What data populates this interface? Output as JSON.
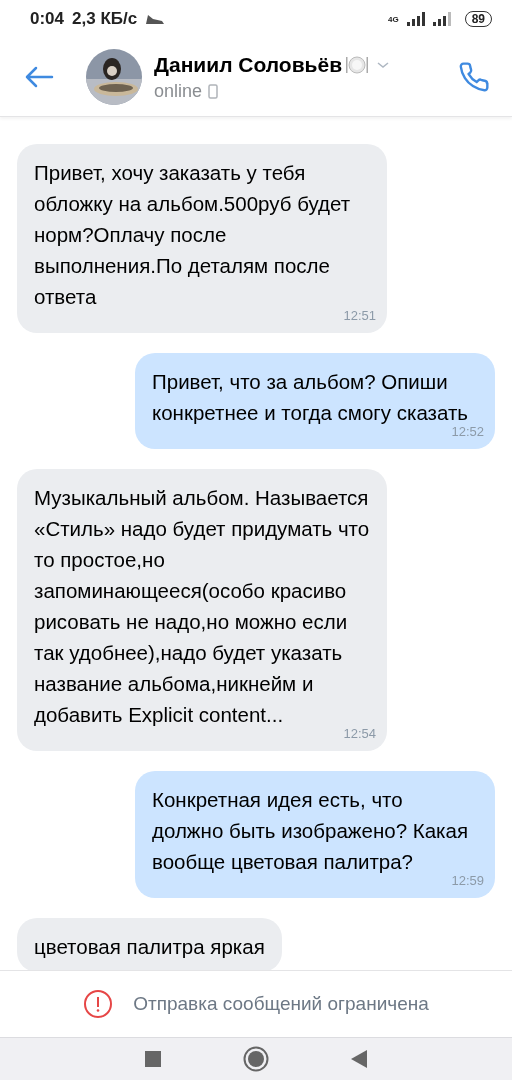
{
  "status_bar": {
    "time": "0:04",
    "speed": "2,3 КБ/с",
    "network": "4G",
    "battery": "89"
  },
  "header": {
    "name": "Даниил Соловьёв",
    "status": "online"
  },
  "messages": [
    {
      "kind": "in",
      "text": "Привет, хочу заказать у тебя обложку на альбом.500руб будет норм?Оплачу после выполнения.По деталям после ответа",
      "time": "12:51"
    },
    {
      "kind": "out",
      "text": "Привет, что за альбом? Опиши конкретнее и тогда смогу сказать",
      "time": "12:52"
    },
    {
      "kind": "in",
      "text": "Музыкальный альбом. Называется «Стиль» надо будет придумать что то простое,но запоминающееся(особо красиво рисовать не надо,но можно если так удобнее),надо будет указать название альбома,никнейм и добавить Explicit content...",
      "time": "12:54"
    },
    {
      "kind": "out",
      "text": "Конкретная идея есть, что должно быть изображено? Какая вообще цветовая палитра?",
      "time": "12:59"
    },
    {
      "kind": "in",
      "text": "цветовая палитра яркая"
    }
  ],
  "notice": "Отправка сообщений ограничена"
}
